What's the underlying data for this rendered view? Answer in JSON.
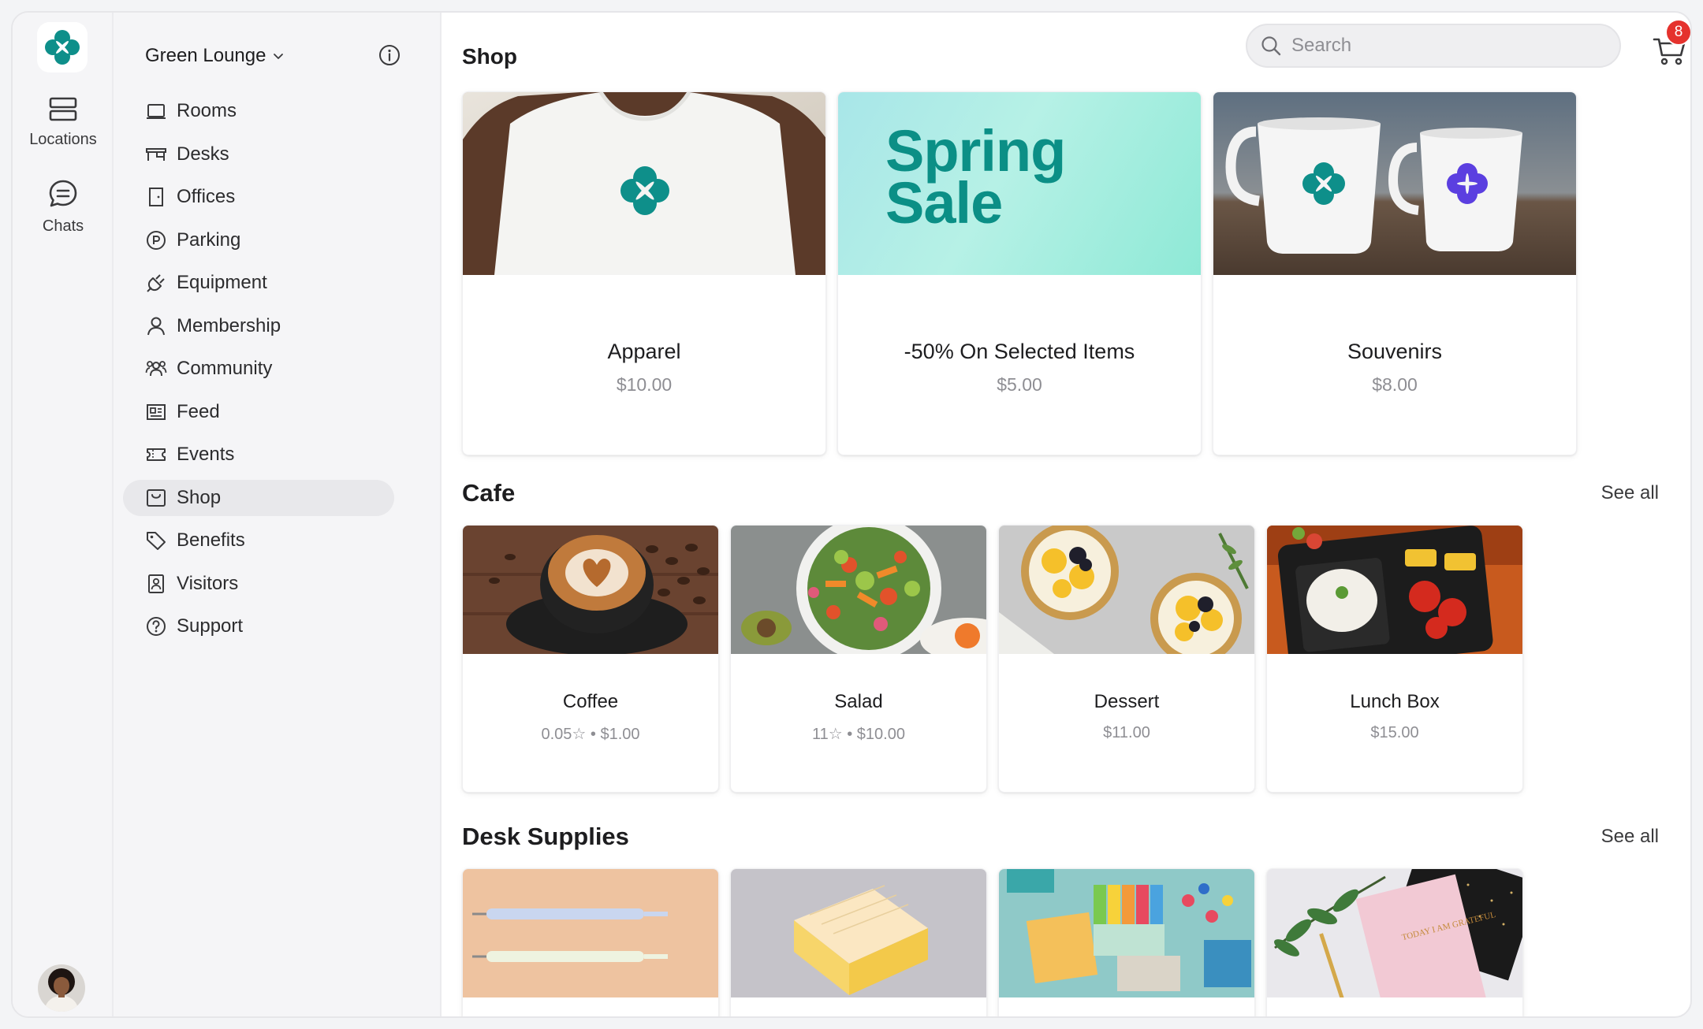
{
  "rail": {
    "items": [
      {
        "label": "Locations",
        "icon": "locations-icon"
      },
      {
        "label": "Chats",
        "icon": "chat-icon"
      }
    ]
  },
  "nav": {
    "workspace": "Green Lounge",
    "active": "Shop",
    "items": [
      {
        "label": "Rooms",
        "icon": "rooms-icon"
      },
      {
        "label": "Desks",
        "icon": "desk-icon"
      },
      {
        "label": "Offices",
        "icon": "door-icon"
      },
      {
        "label": "Parking",
        "icon": "parking-icon"
      },
      {
        "label": "Equipment",
        "icon": "plug-icon"
      },
      {
        "label": "Membership",
        "icon": "person-icon"
      },
      {
        "label": "Community",
        "icon": "people-icon"
      },
      {
        "label": "Feed",
        "icon": "news-icon"
      },
      {
        "label": "Events",
        "icon": "ticket-icon"
      },
      {
        "label": "Shop",
        "icon": "shop-icon"
      },
      {
        "label": "Benefits",
        "icon": "tag-icon"
      },
      {
        "label": "Visitors",
        "icon": "badge-icon"
      },
      {
        "label": "Support",
        "icon": "help-icon"
      }
    ]
  },
  "header": {
    "title": "Shop",
    "search_placeholder": "Search",
    "cart_count": "8"
  },
  "featured": [
    {
      "title": "Apparel",
      "price": "$10.00"
    },
    {
      "title": "-50% On Selected Items",
      "price": "$5.00",
      "banner_line1": "Spring",
      "banner_line2": "Sale"
    },
    {
      "title": "Souvenirs",
      "price": "$8.00"
    }
  ],
  "cafe": {
    "title": "Cafe",
    "see_all": "See all",
    "items": [
      {
        "title": "Coffee",
        "meta": "0.05☆ • $1.00"
      },
      {
        "title": "Salad",
        "meta": "11☆ • $10.00"
      },
      {
        "title": "Dessert",
        "meta": "$11.00"
      },
      {
        "title": "Lunch Box",
        "meta": "$15.00"
      }
    ]
  },
  "desk_supplies": {
    "title": "Desk Supplies",
    "see_all": "See all",
    "notebook_text": "TODAY I AM GRATEFUL"
  },
  "colors": {
    "brand": "#0e8f8a",
    "badge": "#e5322d",
    "nav_active": "#e8e8eb",
    "sale_text": "#0b8f86"
  }
}
